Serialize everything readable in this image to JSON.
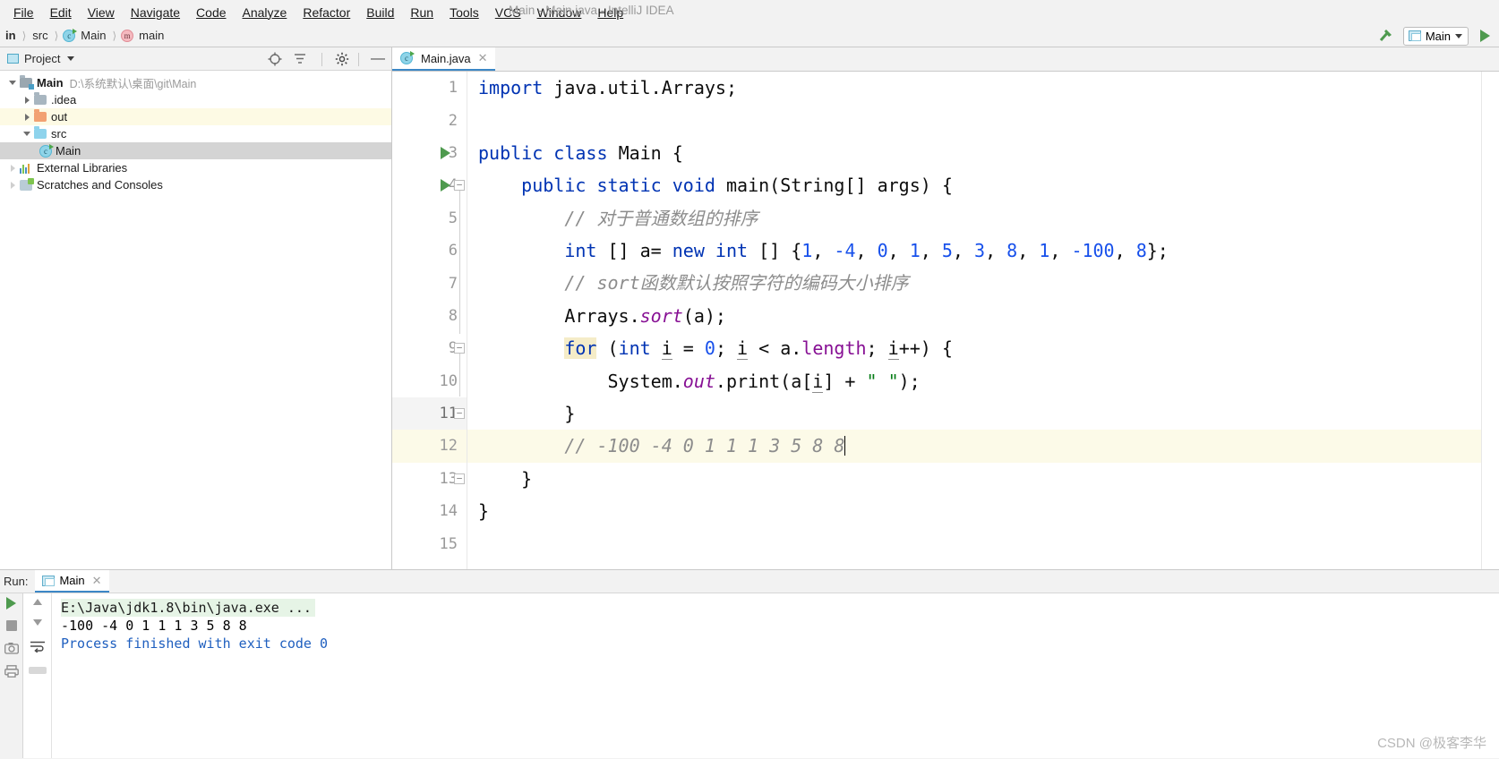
{
  "window": {
    "title": "Main - Main.java - IntelliJ IDEA"
  },
  "menubar": {
    "items": [
      {
        "label": "File",
        "mnemonic": "F"
      },
      {
        "label": "Edit",
        "mnemonic": "E"
      },
      {
        "label": "View",
        "mnemonic": "V"
      },
      {
        "label": "Navigate",
        "mnemonic": "N"
      },
      {
        "label": "Code",
        "mnemonic": "C"
      },
      {
        "label": "Analyze",
        "mnemonic": "z"
      },
      {
        "label": "Refactor",
        "mnemonic": "R"
      },
      {
        "label": "Build",
        "mnemonic": "B"
      },
      {
        "label": "Run",
        "mnemonic": "u"
      },
      {
        "label": "Tools",
        "mnemonic": "T"
      },
      {
        "label": "VCS",
        "mnemonic": "S"
      },
      {
        "label": "Window",
        "mnemonic": "W"
      },
      {
        "label": "Help",
        "mnemonic": "H"
      }
    ]
  },
  "breadcrumb": {
    "items": [
      "in",
      "src",
      "Main",
      "main"
    ],
    "first_label": "in",
    "src_label": "src",
    "class_label": "Main",
    "method_label": "main"
  },
  "toolbar": {
    "build_icon": "hammer-icon",
    "run_config_label": "Main",
    "run_config_icon": "application-icon",
    "dropdown_icon": "chevron-down-icon",
    "run_icon": "run-play-icon"
  },
  "project_panel": {
    "title": "Project",
    "title_dropdown_icon": "chevron-down-icon",
    "locate_icon": "crosshair-icon",
    "collapse_icon": "collapse-all-icon",
    "settings_icon": "gear-icon",
    "hide_icon": "minimize-icon",
    "tree": [
      {
        "label": "Main",
        "detail": "D:\\系统默认\\桌面\\git\\Main",
        "icon": "module-icon",
        "expanded": true,
        "depth": 0,
        "bold": true,
        "state": "normal"
      },
      {
        "label": ".idea",
        "detail": "",
        "icon": "folder-icon",
        "expanded": false,
        "depth": 1,
        "bold": false,
        "state": "normal"
      },
      {
        "label": "out",
        "detail": "",
        "icon": "folder-orange-icon",
        "expanded": false,
        "depth": 1,
        "bold": false,
        "state": "highlighted"
      },
      {
        "label": "src",
        "detail": "",
        "icon": "folder-blue-icon",
        "expanded": true,
        "depth": 1,
        "bold": false,
        "state": "normal"
      },
      {
        "label": "Main",
        "detail": "",
        "icon": "java-class-icon",
        "expanded": null,
        "depth": 2,
        "bold": false,
        "state": "selected"
      },
      {
        "label": "External Libraries",
        "detail": "",
        "icon": "libraries-icon",
        "expanded": false,
        "depth": 0,
        "bold": false,
        "state": "normal"
      },
      {
        "label": "Scratches and Consoles",
        "detail": "",
        "icon": "scratches-icon",
        "expanded": false,
        "depth": 0,
        "bold": false,
        "state": "normal"
      }
    ]
  },
  "editor": {
    "tab": {
      "label": "Main.java",
      "icon": "java-class-icon",
      "close_icon": "close-icon"
    },
    "caret_line": 12,
    "lines": [
      {
        "n": 1,
        "text": "import java.util.Arrays;"
      },
      {
        "n": 2,
        "text": ""
      },
      {
        "n": 3,
        "text": "public class Main {"
      },
      {
        "n": 4,
        "text": "    public static void main(String[] args) {"
      },
      {
        "n": 5,
        "text": "        // 对于普通数组的排序"
      },
      {
        "n": 6,
        "text": "        int [] a= new int [] {1, -4, 0, 1, 5, 3, 8, 1, -100, 8};"
      },
      {
        "n": 7,
        "text": "        // sort函数默认按照字符的编码大小排序"
      },
      {
        "n": 8,
        "text": "        Arrays.sort(a);"
      },
      {
        "n": 9,
        "text": "        for (int i = 0; i < a.length; i++) {"
      },
      {
        "n": 10,
        "text": "            System.out.print(a[i] + \" \");"
      },
      {
        "n": 11,
        "text": "        }"
      },
      {
        "n": 12,
        "text": "        // -100 -4 0 1 1 1 3 5 8 8"
      },
      {
        "n": 13,
        "text": "    }"
      },
      {
        "n": 14,
        "text": "}"
      },
      {
        "n": 15,
        "text": ""
      }
    ],
    "gutter_run_markers": [
      3,
      4
    ],
    "fold_markers": [
      4,
      9,
      11,
      13
    ],
    "code": {
      "l1_kw": "import",
      "l1_rest": " java.util.Arrays;",
      "l3_kw1": "public",
      "l3_kw2": "class",
      "l3_name": "Main",
      "l3_brace": "{",
      "l4_kw1": "public",
      "l4_kw2": "static",
      "l4_kw3": "void",
      "l4_name": "main",
      "l4_rest": "(String[] args) {",
      "l5_comment": "// 对于普通数组的排序",
      "l6_kw": "int",
      "l6_a": " [] a= ",
      "l6_new": "new",
      "l6_int2": "int",
      "l6_mid": " [] {",
      "l6_values": [
        "1",
        "-4",
        "0",
        "1",
        "5",
        "3",
        "8",
        "1",
        "-100",
        "8"
      ],
      "l6_end": "};",
      "l7_comment": "// sort函数默认按照字符的编码大小排序",
      "l8_obj": "Arrays.",
      "l8_method": "sort",
      "l8_args": "(a);",
      "l9_for": "for",
      "l9_p1": " (",
      "l9_int": "int",
      "l9_i1": "i",
      "l9_eq": " = ",
      "l9_zero": "0",
      "l9_semi": "; ",
      "l9_i2": "i",
      "l9_lt": " < a.",
      "l9_length": "length",
      "l9_semi2": "; ",
      "l9_i3": "i",
      "l9_tail": "++) {",
      "l10_sys": "System.",
      "l10_out": "out",
      "l10_print": ".print(a[",
      "l10_i": "i",
      "l10_plus": "] + ",
      "l10_str": "\" \"",
      "l10_end": ");",
      "l11_brace": "}",
      "l12_comment": "// -100 -4 0 1 1 1 3 5 8 8",
      "l13_brace": "}",
      "l14_brace": "}"
    }
  },
  "run_window": {
    "label": "Run:",
    "tab_label": "Main",
    "tab_icon": "application-icon",
    "tab_close_icon": "close-icon",
    "sidebar_icons": [
      "rerun-icon",
      "stop-icon",
      "camera-icon",
      "print-icon"
    ],
    "nav_icons": [
      "scroll-up-icon",
      "scroll-down-icon",
      "soft-wrap-icon",
      "scroll-end-icon"
    ],
    "console": [
      {
        "text": "E:\\Java\\jdk1.8\\bin\\java.exe ...",
        "style": "command"
      },
      {
        "text": "-100 -4 0 1 1 1 3 5 8 8",
        "style": "stdout"
      },
      {
        "text": "Process finished with exit code 0",
        "style": "system"
      }
    ]
  },
  "watermark": {
    "text": "CSDN @极客李华"
  },
  "colors": {
    "accent": "#3c87c6",
    "keyword": "#0033b3",
    "number": "#1750eb",
    "string": "#067d17",
    "comment": "#8c8c8c",
    "field": "#871094",
    "run_green": "#4e9a4e",
    "console_cmd_bg": "#e6f4e6",
    "selection": "#d4d4d4",
    "current_line": "#fcfae8"
  }
}
